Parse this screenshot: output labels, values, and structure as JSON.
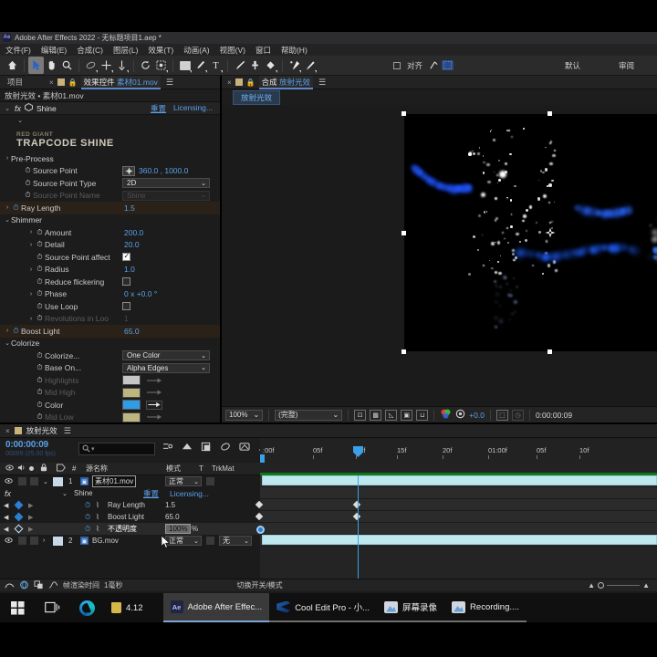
{
  "titlebar": {
    "app_badge": "Ae",
    "title": "Adobe After Effects 2022 - 无标题项目1.aep *"
  },
  "menubar": {
    "items": [
      "文件(F)",
      "编辑(E)",
      "合成(C)",
      "图层(L)",
      "效果(T)",
      "动画(A)",
      "视图(V)",
      "窗口",
      "帮助(H)"
    ]
  },
  "toolbar": {
    "tools": [
      {
        "name": "home-icon",
        "glyph": "⌂"
      },
      {
        "name": "selection-tool-icon",
        "glyph": "➤"
      },
      {
        "name": "hand-tool-icon",
        "glyph": "✋"
      },
      {
        "name": "zoom-tool-icon",
        "glyph": "🔍"
      },
      {
        "name": "orbit-tool-icon",
        "glyph": "↺"
      },
      {
        "name": "pan-behind-tool-icon",
        "glyph": "✛"
      },
      {
        "name": "camera-tool-icon",
        "glyph": "↧"
      },
      {
        "name": "rotation-tool-icon",
        "glyph": "⟳"
      },
      {
        "name": "roto-brush-tool-icon",
        "glyph": "▦"
      },
      {
        "name": "shape-tool-icon",
        "glyph": "▭"
      },
      {
        "name": "pen-tool-icon",
        "glyph": "✒"
      },
      {
        "name": "text-tool-icon",
        "glyph": "T"
      },
      {
        "name": "brush-tool-icon",
        "glyph": "🖌"
      },
      {
        "name": "clone-stamp-tool-icon",
        "glyph": "⎙"
      },
      {
        "name": "eraser-tool-icon",
        "glyph": "◆"
      },
      {
        "name": "puppet-pin-tool-icon",
        "glyph": "✜"
      },
      {
        "name": "puppet-starch-tool-icon",
        "glyph": "✦"
      }
    ],
    "align_label": "对齐",
    "workspace_default": "默认",
    "workspace_review": "审阅"
  },
  "left_panel": {
    "tab_project": "项目",
    "tab_close": "×",
    "tab_effect_controls": "效果控件",
    "tab_effect_target": "素材01.mov",
    "header": "放射光效 • 素材01.mov",
    "effect_name": "Shine",
    "reset_label": "重置",
    "licensing_label": "Licensing...",
    "brand_small": "RED GIANT",
    "brand_large": "TRAPCODE SHINE",
    "params": [
      {
        "name": "Pre-Process",
        "type": "group",
        "indent": 1,
        "open": false
      },
      {
        "name": "Source Point",
        "type": "point",
        "indent": 2,
        "value": "360.0 , 1000.0"
      },
      {
        "name": "Source Point Type",
        "type": "dropdown",
        "indent": 2,
        "value": "2D"
      },
      {
        "name": "Source Point Name",
        "type": "dropdown",
        "indent": 2,
        "value": "Shine",
        "dim": true
      },
      {
        "name": "Ray Length",
        "type": "value",
        "indent": 1,
        "value": "1.5",
        "highlight": true,
        "stopwatch_on": true,
        "expandable": true
      },
      {
        "name": "Shimmer",
        "type": "group",
        "indent": 1,
        "open": true
      },
      {
        "name": "Amount",
        "type": "value",
        "indent": 3,
        "value": "200.0",
        "expandable": true
      },
      {
        "name": "Detail",
        "type": "value",
        "indent": 3,
        "value": "20.0",
        "expandable": true
      },
      {
        "name": "Source Point affect",
        "type": "checkbox",
        "indent": 3,
        "checked": true
      },
      {
        "name": "Radius",
        "type": "value",
        "indent": 3,
        "value": "1.0",
        "expandable": true
      },
      {
        "name": "Reduce flickering",
        "type": "checkbox",
        "indent": 3,
        "checked": false
      },
      {
        "name": "Phase",
        "type": "angle",
        "indent": 3,
        "value": "0 x +0.0 °",
        "expandable": true
      },
      {
        "name": "Use Loop",
        "type": "checkbox",
        "indent": 3,
        "checked": false
      },
      {
        "name": "Revolutions in Loo",
        "type": "value",
        "indent": 3,
        "value": "1",
        "dim": true,
        "expandable": true
      },
      {
        "name": "Boost Light",
        "type": "value",
        "indent": 1,
        "value": "65.0",
        "highlight": true,
        "stopwatch_on": true,
        "expandable": true
      },
      {
        "name": "Colorize",
        "type": "group",
        "indent": 1,
        "open": true
      },
      {
        "name": "Colorize...",
        "type": "dropdown",
        "indent": 3,
        "value": "One Color"
      },
      {
        "name": "Base On...",
        "type": "dropdown",
        "indent": 3,
        "value": "Alpha Edges"
      },
      {
        "name": "Highlights",
        "type": "color",
        "indent": 3,
        "color": "#ffffff",
        "dim": true
      },
      {
        "name": "Mid High",
        "type": "color",
        "indent": 3,
        "color": "#f2e9a0",
        "dim": true
      },
      {
        "name": "Color",
        "type": "color",
        "indent": 3,
        "color": "#2f9ce8"
      },
      {
        "name": "Mid Low",
        "type": "color",
        "indent": 3,
        "color": "#f2e9a0",
        "dim": true
      }
    ]
  },
  "comp_panel": {
    "tab_close": "×",
    "tab_label": "合成",
    "tab_name": "放射光效",
    "breadcrumb": "放射光效",
    "bottom": {
      "zoom": "100%",
      "resolution": "(完整)",
      "exposure": "+0.0",
      "timecode": "0:00:00:09",
      "icons": [
        {
          "name": "region-of-interest-icon"
        },
        {
          "name": "transparency-grid-icon"
        },
        {
          "name": "3d-view-icon"
        },
        {
          "name": "mask-view-icon"
        },
        {
          "name": "timeline-view-icon"
        },
        {
          "name": "channel-color-icon"
        },
        {
          "name": "exposure-reset-icon"
        },
        {
          "name": "snapshot-icon"
        },
        {
          "name": "show-snapshot-icon"
        }
      ]
    }
  },
  "timeline": {
    "tab_close": "×",
    "tab_name": "放射光效",
    "current_time": "0:00:00:09",
    "current_time_sub": "00009 (25.00 fps)",
    "search_placeholder": "",
    "columns": {
      "source_name": "源名称",
      "mode": "模式",
      "t": "T",
      "trkmat": "TrkMat"
    },
    "ruler_ticks": [
      ":00f",
      "05f",
      "10f",
      "15f",
      "20f",
      "01:00f",
      "05f",
      "10f"
    ],
    "rows": [
      {
        "kind": "layer",
        "index": "1",
        "name": "素材01.mov",
        "mode": "正常",
        "trkmat": "",
        "selected_name": true
      },
      {
        "kind": "effect",
        "name": "Shine",
        "reset": "重置",
        "licensing": "Licensing..."
      },
      {
        "kind": "prop",
        "name": "Ray Length",
        "value": "1.5"
      },
      {
        "kind": "prop",
        "name": "Boost Light",
        "value": "65.0"
      },
      {
        "kind": "prop",
        "name": "不透明度",
        "value": "100%",
        "unit": "%",
        "editing": true
      },
      {
        "kind": "layer",
        "index": "2",
        "name": "BG.mov",
        "mode": "正常",
        "trkmat": "无"
      }
    ],
    "footer": {
      "render_time_label": "帧渲染时间",
      "render_time_value": "1毫秒",
      "toggle_label": "切换开关/模式"
    }
  },
  "taskbar": {
    "start": {
      "name": "start-button"
    },
    "taskview": {
      "name": "task-view-button"
    },
    "edge": {
      "name": "edge-browser-button"
    },
    "folder_label": "4.12",
    "apps": [
      {
        "name": "adobe-after-effects",
        "label": "Adobe After Effec...",
        "icon": "ae",
        "active": true
      },
      {
        "name": "cool-edit-pro",
        "label": "Cool Edit Pro  - 小...",
        "icon": "cep",
        "active": false
      },
      {
        "name": "screen-recorder",
        "label": "屏幕录像",
        "icon": "rec",
        "active": false
      },
      {
        "name": "recording",
        "label": "Recording....",
        "icon": "rec",
        "active": false
      }
    ]
  },
  "colors": {
    "accent_blue": "#5aa0e8",
    "layer_bar": "#bfe7ee",
    "green_bar": "#0a7a18",
    "highlight_row": "#2a2119"
  }
}
